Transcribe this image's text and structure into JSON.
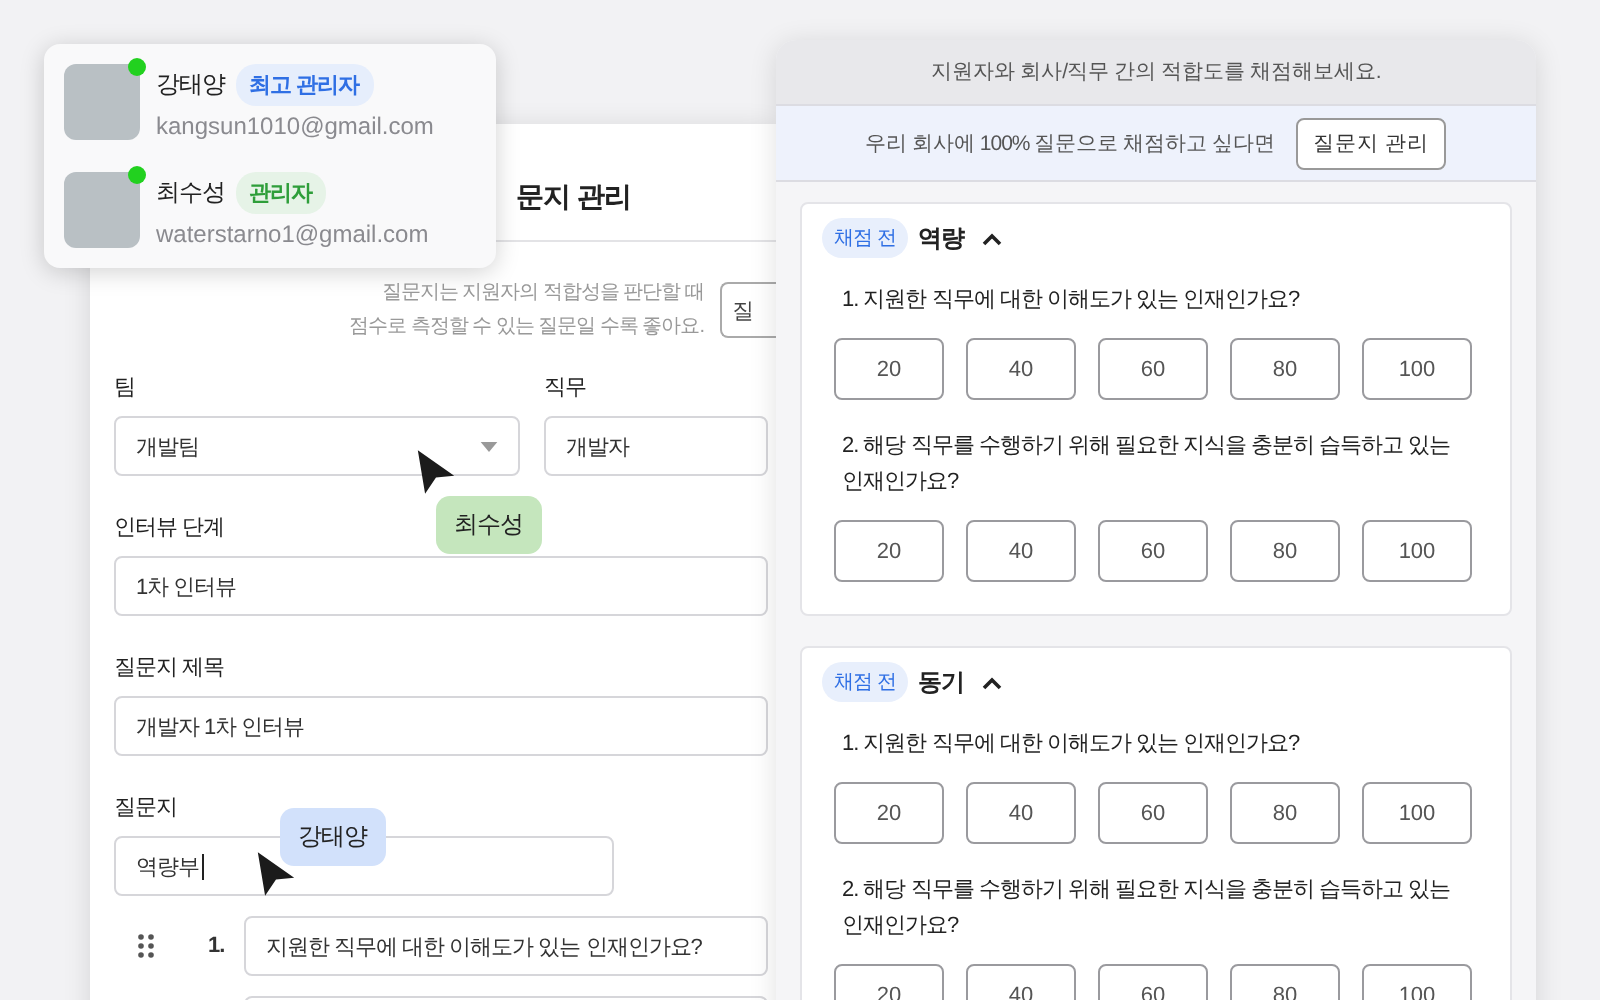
{
  "collaborators_popup": {
    "users": [
      {
        "name": "강태양",
        "role": "최고 관리자",
        "color": "#2f6fe4",
        "email": "kangsun1010@gmail.com",
        "online": true
      },
      {
        "name": "최수성",
        "role": "관리자",
        "color": "#2e9e3a",
        "email": "waterstarno1@gmail.com",
        "online": true
      }
    ]
  },
  "form_window": {
    "title": "문지 관리",
    "hint": "질문지는 지원자의 적합성을 판단할 때\n점수로 측정할 수 있는 질문일 수록 좋아요.",
    "hint_button": "질",
    "fields": [
      {
        "kind": "select",
        "label": "팀",
        "value": "개발팀"
      },
      {
        "kind": "text",
        "label": "직무",
        "value": "개발자"
      },
      {
        "kind": "text",
        "label": "인터뷰 단계",
        "value": "1차 인터뷰"
      },
      {
        "kind": "text",
        "label": "질문지 제목",
        "value": "개발자 1차 인터뷰"
      },
      {
        "kind": "editing",
        "label": "질문지",
        "value": "역량부"
      }
    ],
    "questions": [
      {
        "kind": "filled",
        "number": "1.",
        "text": "지원한 직무에 대한 이해도가 있는 인재인가요?"
      },
      {
        "kind": "blank"
      }
    ]
  },
  "cursors": [
    {
      "name": "최수성",
      "color": "#c5e6bd"
    },
    {
      "name": "강태양",
      "color": "#d2e1fb"
    }
  ],
  "scoring_window": {
    "header": "지원자와 회사/직무 간의 적합도를 채점해보세요.",
    "banner_text": "우리 회사에 100% 질문으로 채점하고 싶다면",
    "banner_button": "질문지 관리",
    "sections": [
      {
        "status": "채점 전",
        "title": "역량",
        "expanded": true,
        "questions": [
          {
            "text": "1. 지원한 직무에 대한 이해도가 있는 인재인가요?",
            "options": [
              {
                "label": "20",
                "selected": false
              },
              {
                "label": "40",
                "selected": false
              },
              {
                "label": "60",
                "selected": false
              },
              {
                "label": "80",
                "selected": false
              },
              {
                "label": "100",
                "selected": false
              }
            ]
          },
          {
            "text": "2. 해당 직무를 수행하기 위해 필요한 지식을 충분히 습득하고 있는 인재인가요?",
            "options": [
              {
                "label": "20",
                "selected": false
              },
              {
                "label": "40",
                "selected": false
              },
              {
                "label": "60",
                "selected": false
              },
              {
                "label": "80",
                "selected": false
              },
              {
                "label": "100",
                "selected": false
              }
            ]
          }
        ]
      },
      {
        "status": "채점 전",
        "title": "동기",
        "expanded": true,
        "questions": [
          {
            "text": "1. 지원한 직무에 대한 이해도가 있는 인재인가요?",
            "options": [
              {
                "label": "20",
                "selected": false
              },
              {
                "label": "40",
                "selected": false
              },
              {
                "label": "60",
                "selected": false
              },
              {
                "label": "80",
                "selected": false
              },
              {
                "label": "100",
                "selected": false
              }
            ]
          },
          {
            "text": "2. 해당 직무를 수행하기 위해 필요한 지식을 충분히 습득하고 있는 인재인가요?",
            "options": [
              {
                "label": "20",
                "selected": false
              },
              {
                "label": "40",
                "selected": false
              },
              {
                "label": "60",
                "selected": false
              },
              {
                "label": "80",
                "selected": false
              },
              {
                "label": "100",
                "selected": false
              }
            ]
          }
        ]
      }
    ]
  }
}
